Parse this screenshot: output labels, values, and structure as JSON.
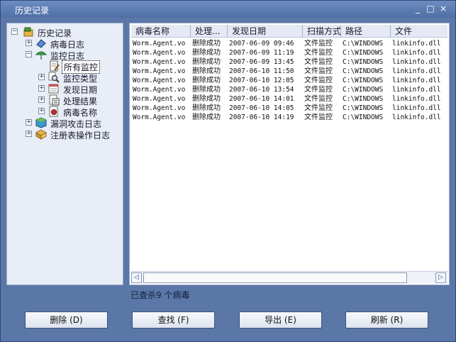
{
  "window": {
    "title": "历史记录",
    "minimize_glyph": "_",
    "maximize_glyph": "□",
    "close_glyph": "×"
  },
  "tree": {
    "root": "历史记录",
    "virus_log": "病毒日志",
    "monitor_log": "监控日志",
    "all_monitor": "所有监控",
    "monitor_type": "监控类型",
    "found_date": "发现日期",
    "result": "处理结果",
    "virus_name": "病毒名称",
    "vuln_log": "漏洞攻击日志",
    "registry_log": "注册表操作日志",
    "expand_glyph": "+",
    "collapse_glyph": "−"
  },
  "table": {
    "headers": {
      "name": "病毒名称",
      "action": "处理...",
      "date": "发现日期",
      "method": "扫描方式",
      "path": "路径",
      "file": "文件"
    },
    "rows": [
      {
        "name": "Worm.Agent.vo",
        "action": "删除成功",
        "date": "2007-06-09 09:46",
        "method": "文件监控",
        "path": "C:\\WINDOWS",
        "file": "linkinfo.dll"
      },
      {
        "name": "Worm.Agent.vo",
        "action": "删除成功",
        "date": "2007-06-09 11:19",
        "method": "文件监控",
        "path": "C:\\WINDOWS",
        "file": "linkinfo.dll"
      },
      {
        "name": "Worm.Agent.vo",
        "action": "删除成功",
        "date": "2007-06-09 13:45",
        "method": "文件监控",
        "path": "C:\\WINDOWS",
        "file": "linkinfo.dll"
      },
      {
        "name": "Worm.Agent.vo",
        "action": "删除成功",
        "date": "2007-06-10 11:50",
        "method": "文件监控",
        "path": "C:\\WINDOWS",
        "file": "linkinfo.dll"
      },
      {
        "name": "Worm.Agent.vo",
        "action": "删除成功",
        "date": "2007-06-10 12:05",
        "method": "文件监控",
        "path": "C:\\WINDOWS",
        "file": "linkinfo.dll"
      },
      {
        "name": "Worm.Agent.vo",
        "action": "删除成功",
        "date": "2007-06-10 13:54",
        "method": "文件监控",
        "path": "C:\\WINDOWS",
        "file": "linkinfo.dll"
      },
      {
        "name": "Worm.Agent.vo",
        "action": "删除成功",
        "date": "2007-06-10 14:01",
        "method": "文件监控",
        "path": "C:\\WINDOWS",
        "file": "linkinfo.dll"
      },
      {
        "name": "Worm.Agent.vo",
        "action": "删除成功",
        "date": "2007-06-10 14:05",
        "method": "文件监控",
        "path": "C:\\WINDOWS",
        "file": "linkinfo.dll"
      },
      {
        "name": "Worm.Agent.vo",
        "action": "删除成功",
        "date": "2007-06-10 14:19",
        "method": "文件监控",
        "path": "C:\\WINDOWS",
        "file": "linkinfo.dll"
      }
    ]
  },
  "scrollbar": {
    "left_glyph": "◁",
    "right_glyph": "▷"
  },
  "status": {
    "text": "已查杀9 个病毒"
  },
  "buttons": {
    "delete": "删除 (D)",
    "find": "查找 (F)",
    "export": "导出 (E)",
    "refresh": "刷新 (R)"
  },
  "colors": {
    "window_bg": "#5b77a8",
    "panel_bg": "#e8edf6",
    "title_bar": "#4f6fa6"
  }
}
